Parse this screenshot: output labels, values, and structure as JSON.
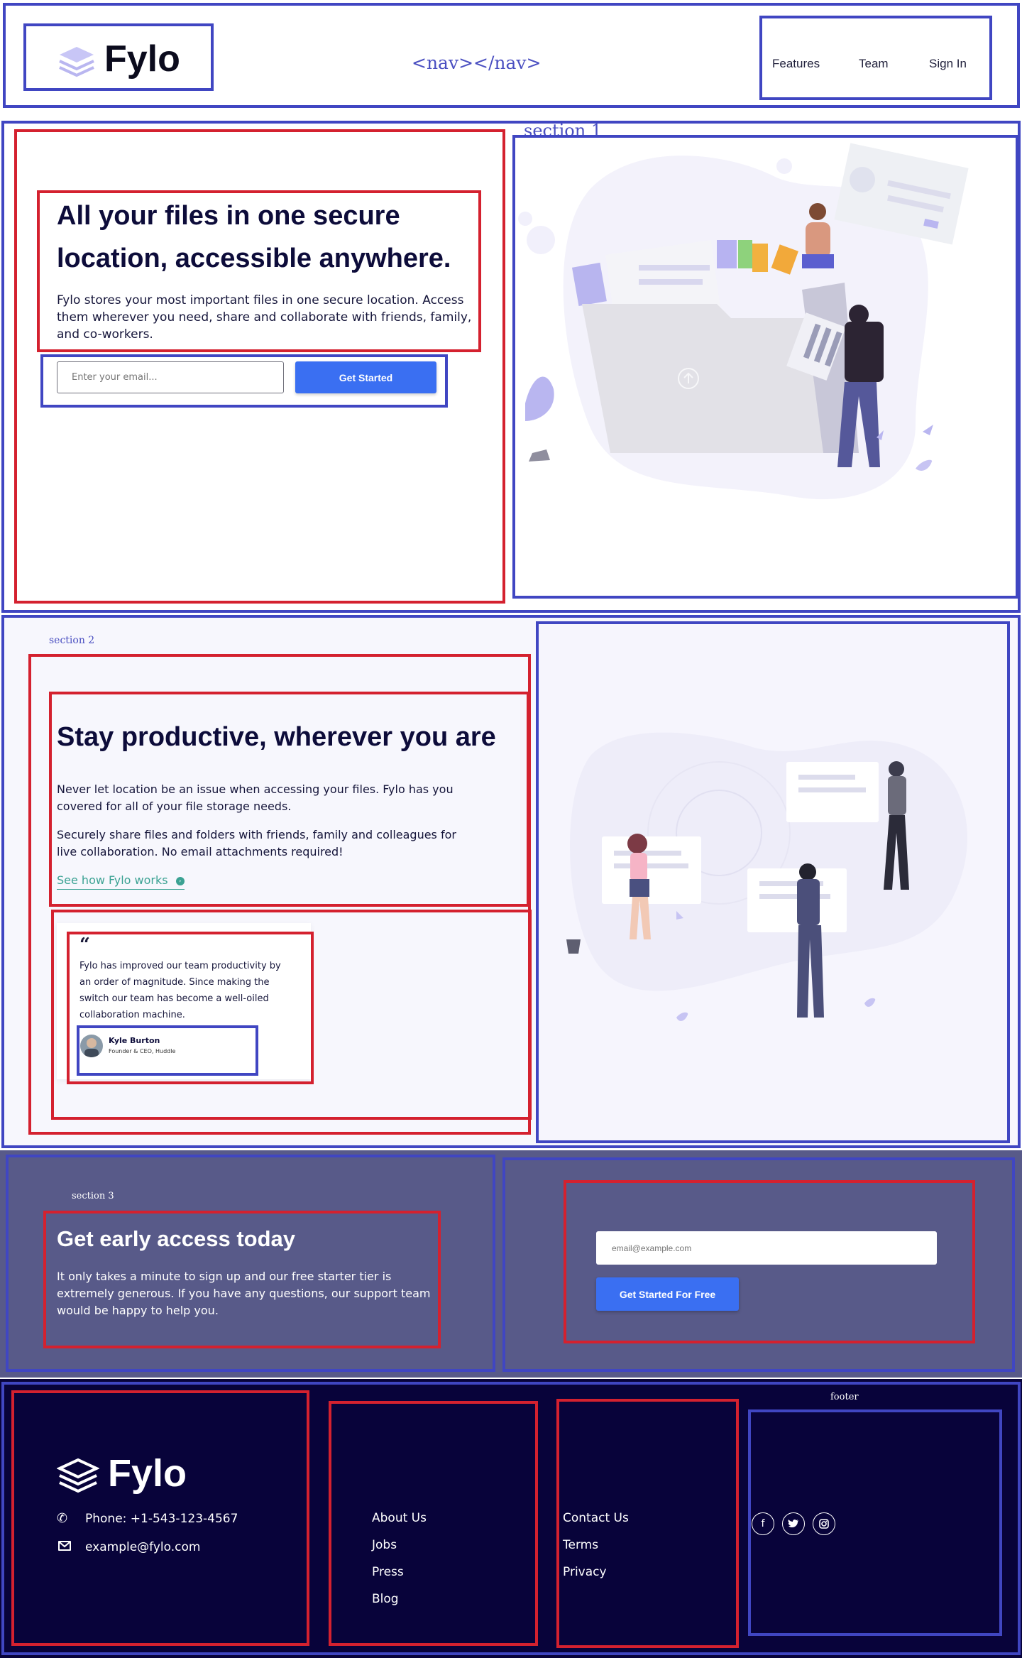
{
  "header": {
    "brand": "Fylo",
    "nav_tag": "<nav></nav>",
    "nav": [
      "Features",
      "Team",
      "Sign In"
    ]
  },
  "hero": {
    "section_label": "section 1",
    "title_line1": "All your files in one secure",
    "title_line2": "location, accessible anywhere.",
    "body_line1": "Fylo stores your most important files in one secure location. Access",
    "body_line2": "them wherever you need, share and collaborate with friends, family,",
    "body_line3": "and co-workers.",
    "email_placeholder": "Enter your email...",
    "cta": "Get Started"
  },
  "productive": {
    "section_label": "section 2",
    "title": "Stay productive, wherever you are",
    "p1_line1": "Never let location be an issue when accessing your files. Fylo has you",
    "p1_line2": "covered for all of your file storage needs.",
    "p2_line1": "Securely share files and folders with friends, family and colleagues for",
    "p2_line2": "live collaboration. No email attachments required!",
    "link": "See how Fylo works",
    "quote_mark": "“",
    "quote_line1": "Fylo has improved our team productivity by",
    "quote_line2": "an order of magnitude. Since making the",
    "quote_line3": "switch our team has become a well-oiled",
    "quote_line4": "collaboration machine.",
    "person_name": "Kyle Burton",
    "person_role": "Founder & CEO, Huddle"
  },
  "early_access": {
    "section_label": "section 3",
    "title": "Get early access today",
    "body_line1": "It only takes a minute to sign up and our free starter tier is",
    "body_line2": "extremely generous. If you have any questions, our support team",
    "body_line3": "would be happy to help you.",
    "email_placeholder": "email@example.com",
    "cta": "Get Started For Free"
  },
  "footer": {
    "label": "footer",
    "brand": "Fylo",
    "phone": "Phone: +1-543-123-4567",
    "email": "example@fylo.com",
    "col1": [
      "About Us",
      "Jobs",
      "Press",
      "Blog"
    ],
    "col2": [
      "Contact Us",
      "Terms",
      "Privacy"
    ],
    "social": [
      "facebook-icon",
      "twitter-icon",
      "instagram-icon"
    ]
  },
  "colors": {
    "outline_blue": "#4046c2",
    "outline_red": "#d4212f",
    "cta_blue": "#3a6ff2",
    "navy": "#0d0c3a",
    "access_bg": "#585a89",
    "footer_bg": "#08033a",
    "link_teal": "#3ba293"
  }
}
